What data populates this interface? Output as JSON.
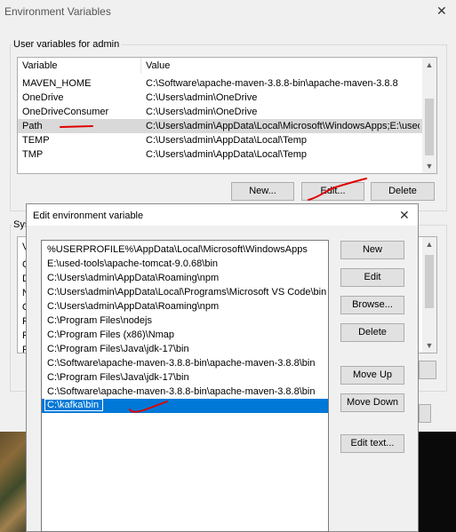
{
  "outer_dialog": {
    "title": "Environment Variables",
    "user_group_label": "User variables for admin",
    "system_group_label": "Sys",
    "columns": [
      "Variable",
      "Value"
    ],
    "rows": [
      {
        "variable": "MAVEN_HOME",
        "value": "C:\\Software\\apache-maven-3.8.8-bin\\apache-maven-3.8.8"
      },
      {
        "variable": "OneDrive",
        "value": "C:\\Users\\admin\\OneDrive"
      },
      {
        "variable": "OneDriveConsumer",
        "value": "C:\\Users\\admin\\OneDrive"
      },
      {
        "variable": "Path",
        "value": "C:\\Users\\admin\\AppData\\Local\\Microsoft\\WindowsApps;E:\\used-t..."
      },
      {
        "variable": "TEMP",
        "value": "C:\\Users\\admin\\AppData\\Local\\Temp"
      },
      {
        "variable": "TMP",
        "value": "C:\\Users\\admin\\AppData\\Local\\Temp"
      }
    ],
    "selected_row": "Path",
    "buttons": {
      "new": "New...",
      "edit": "Edit...",
      "delete": "Delete"
    },
    "system_row_initials": [
      "V",
      "C",
      "D",
      "N",
      "O",
      "P",
      "P",
      "P"
    ]
  },
  "edit_dialog": {
    "title": "Edit environment variable",
    "entries": [
      "%USERPROFILE%\\AppData\\Local\\Microsoft\\WindowsApps",
      "E:\\used-tools\\apache-tomcat-9.0.68\\bin",
      "C:\\Users\\admin\\AppData\\Roaming\\npm",
      "C:\\Users\\admin\\AppData\\Local\\Programs\\Microsoft VS Code\\bin",
      "C:\\Users\\admin\\AppData\\Roaming\\npm",
      "C:\\Program Files\\nodejs",
      "C:\\Program Files (x86)\\Nmap",
      "C:\\Program Files\\Java\\jdk-17\\bin",
      "C:\\Software\\apache-maven-3.8.8-bin\\apache-maven-3.8.8\\bin",
      "C:\\Program Files\\Java\\jdk-17\\bin",
      "C:\\Software\\apache-maven-3.8.8-bin\\apache-maven-3.8.8\\bin"
    ],
    "editing_value": "C:\\kafka\\bin",
    "buttons": {
      "new": "New",
      "edit": "Edit",
      "browse": "Browse...",
      "delete": "Delete",
      "move_up": "Move Up",
      "move_down": "Move Down",
      "edit_text": "Edit text..."
    }
  },
  "colors": {
    "selection": "#0078d7",
    "annotation": "#e00000",
    "dialog_bg": "#f0f0f0"
  }
}
